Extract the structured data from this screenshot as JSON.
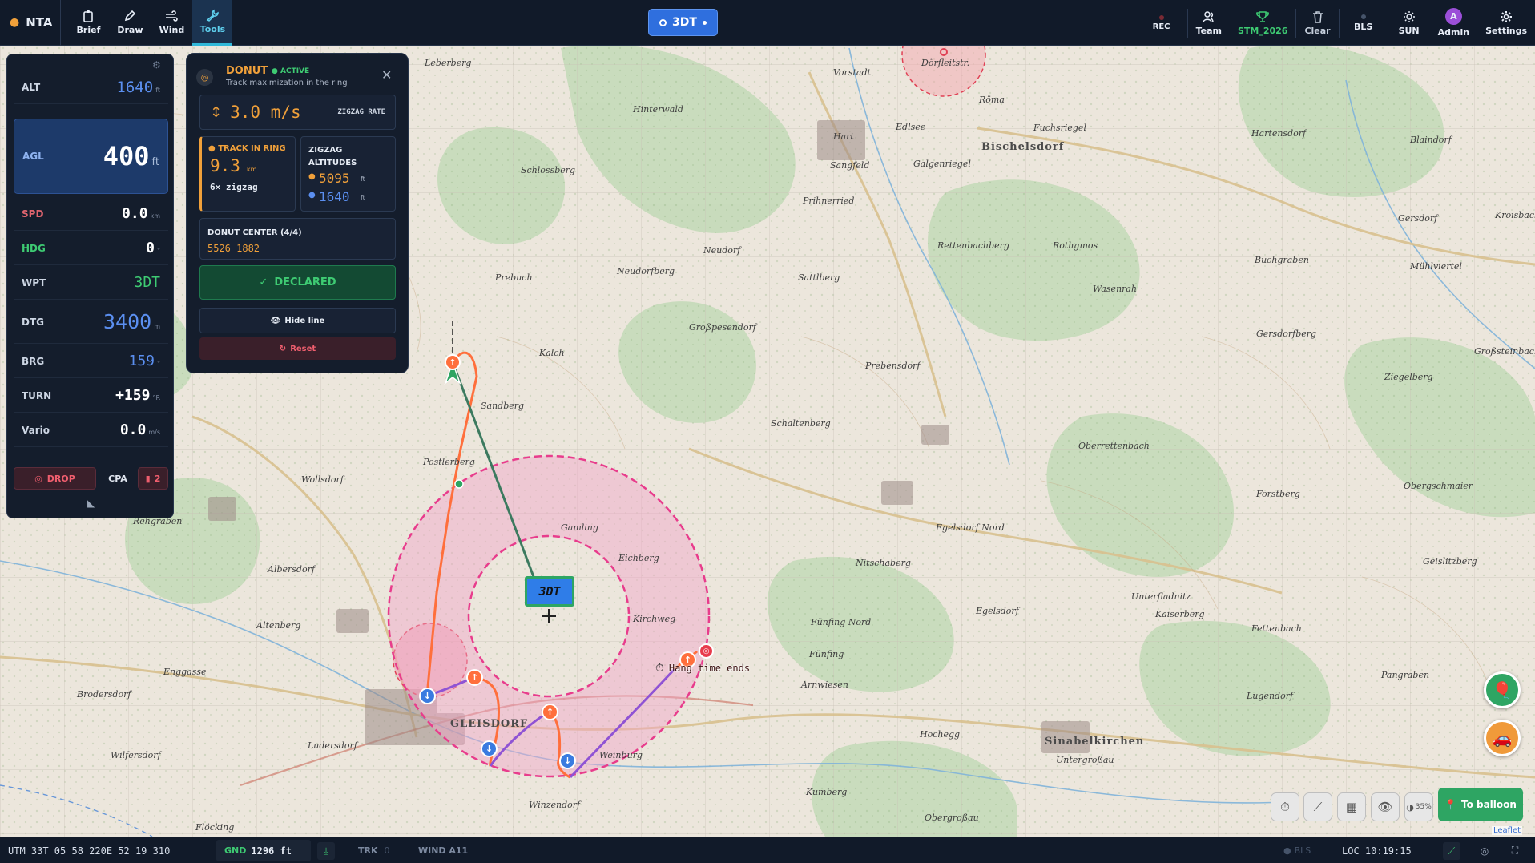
{
  "topbar": {
    "brand": "NTA",
    "left_buttons": [
      {
        "label": "Brief",
        "icon": "clipboard-icon"
      },
      {
        "label": "Draw",
        "icon": "pencil-icon"
      },
      {
        "label": "Wind",
        "icon": "wind-icon"
      },
      {
        "label": "Tools",
        "icon": "wrench-icon"
      }
    ],
    "waypoint": "3DT",
    "right_buttons": {
      "rec": "REC",
      "team": "Team",
      "competition": "STM_2026",
      "clear": "Clear",
      "bls": "BLS",
      "sun": "SUN",
      "admin": "Admin",
      "admin_initial": "A",
      "settings": "Settings"
    }
  },
  "flight": {
    "alt": {
      "label": "ALT",
      "value": "1640",
      "unit": "ft"
    },
    "agl": {
      "label": "AGL",
      "value": "400",
      "unit": "ft"
    },
    "spd": {
      "label": "SPD",
      "value": "0.0",
      "unit": "km"
    },
    "hdg": {
      "label": "HDG",
      "value": "0",
      "unit": "°"
    },
    "wpt": {
      "label": "WPT",
      "value": "3DT"
    },
    "dtg": {
      "label": "DTG",
      "value": "3400",
      "unit": "m"
    },
    "brg": {
      "label": "BRG",
      "value": "159",
      "unit": "°"
    },
    "turn": {
      "label": "TURN",
      "value": "+159",
      "unit": "°R"
    },
    "vario": {
      "label": "Vario",
      "value": "0.0",
      "unit": "m/s"
    },
    "drop": "DROP",
    "cpa": "CPA",
    "marker_count": "2"
  },
  "donut": {
    "title": "DONUT",
    "status": "ACTIVE",
    "subtitle": "Track maximization in the ring",
    "rate_value": "3.0 m/s",
    "rate_label": "ZIGZAG RATE",
    "track_label": "TRACK IN RING",
    "track_value": "9.3",
    "track_unit": "km",
    "track_sub": "6× zigzag",
    "zigzag_label": "ZIGZAG ALTITUDES",
    "zigzag_high": "5095",
    "zigzag_low": "1640",
    "zigzag_unit": "ft",
    "center_label": "DONUT CENTER (4/4)",
    "center_value": "5526 1882",
    "declared": "DECLARED",
    "hide_line": "Hide line",
    "reset": "Reset"
  },
  "map": {
    "target_label": "3DT",
    "hang_label": "Hang time ends",
    "opacity": "35%",
    "to_balloon": "To balloon",
    "attribution": "Leaflet",
    "places": {
      "p01": "Vorstadt",
      "p02": "Dörfleitstr.",
      "p03": "Röma",
      "p04": "Bischelsdorf",
      "p05": "Fuchsriegel",
      "p06": "Hartensdorf",
      "p07": "Blaindorf",
      "p08": "Kroisbach",
      "p09": "Hinterwald",
      "p10": "Hart",
      "p11": "Sangfeld",
      "p12": "Edlsee",
      "p13": "Galgenriegel",
      "p14": "Leberberg",
      "p15": "Gersdorf",
      "p16": "Mühlviertel",
      "p17": "Neudorf",
      "p18": "Prihnerried",
      "p19": "Rettenbachberg",
      "p20": "Rothgmos",
      "p21": "Schlossberg",
      "p22": "Neudorfberg",
      "p23": "Prebuch",
      "p24": "Wasenrah",
      "p25": "Kalch",
      "p26": "Großpesendorf",
      "p27": "Sattlberg",
      "p28": "Buchgraben",
      "p29": "Gersdorfberg",
      "p30": "Großsteinbach",
      "p31": "Prebensdorf",
      "p32": "Ziegelberg",
      "p33": "Schaltenberg",
      "p34": "Sandberg",
      "p35": "Oberrettenbach",
      "p36": "Postlerberg",
      "p37": "Wollsdorf",
      "p38": "Obergschmaier",
      "p39": "Forstberg",
      "p40": "Gamling",
      "p41": "Egelsdorf Nord",
      "p42": "Albersdorf",
      "p43": "Rehgraben",
      "p44": "Nitschaberg",
      "p45": "Geislitzberg",
      "p46": "Egelsdorf",
      "p47": "Eichberg",
      "p48": "Kirchweg",
      "p49": "Fünfing Nord",
      "p50": "Unterfladnitz",
      "p51": "Altenberg",
      "p52": "Enggasse",
      "p53": "Kaiserberg",
      "p54": "Fettenbach",
      "p55": "Fünfing",
      "p56": "Pangraben",
      "p57": "Brodersdorf",
      "p58": "GLEISDORF",
      "p59": "Arnwiesen",
      "p60": "Lugendorf",
      "p61": "Wilfersdorf",
      "p62": "Ludersdorf",
      "p63": "Sinabelkirchen",
      "p64": "Hochegg",
      "p65": "Untergroßau",
      "p66": "Winzendorf",
      "p67": "Kumberg",
      "p68": "Obergroßau",
      "p69": "Flöcking",
      "p70": "Weinburg"
    }
  },
  "bottombar": {
    "utm": "UTM 33T 05 58 220E 52 19 310",
    "gnd_label": "GND",
    "gnd_value": "1296 ft",
    "trk_label": "TRK",
    "trk_value": "0",
    "wind": "WIND A11",
    "bls": "BLS",
    "loc": "LOC 10:19:15"
  },
  "colors": {
    "accent": "#2f6fde",
    "orange": "#ff6f3c",
    "donut_ring": "#e83c8c",
    "green": "#2ea563",
    "track_line": "#3c7a5f",
    "purple": "#8f53d4"
  }
}
